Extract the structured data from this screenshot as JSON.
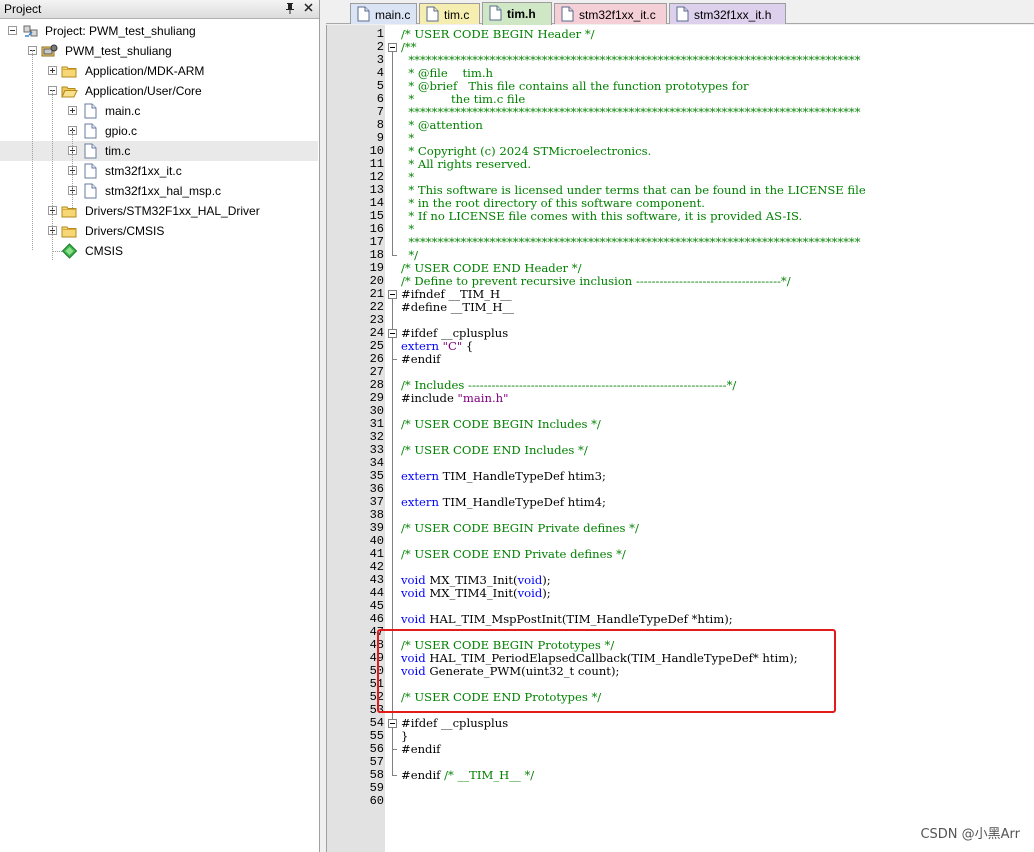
{
  "project_panel": {
    "title": "Project",
    "pin_icon": "pin-icon",
    "close_icon": "close-icon",
    "tree": [
      {
        "label": "Project: PWM_test_shuliang",
        "icon": "project-icon",
        "depth": 0,
        "toggle": "minus"
      },
      {
        "label": "PWM_test_shuliang",
        "icon": "target-icon",
        "depth": 1,
        "toggle": "minus"
      },
      {
        "label": "Application/MDK-ARM",
        "icon": "folder-icon",
        "depth": 2,
        "toggle": "plus"
      },
      {
        "label": "Application/User/Core",
        "icon": "folder-open-icon",
        "depth": 2,
        "toggle": "minus"
      },
      {
        "label": "main.c",
        "icon": "file-icon",
        "depth": 3,
        "toggle": "plus"
      },
      {
        "label": "gpio.c",
        "icon": "file-icon",
        "depth": 3,
        "toggle": "plus"
      },
      {
        "label": "tim.c",
        "icon": "file-icon",
        "depth": 3,
        "toggle": "plus",
        "selected": true
      },
      {
        "label": "stm32f1xx_it.c",
        "icon": "file-icon",
        "depth": 3,
        "toggle": "plus"
      },
      {
        "label": "stm32f1xx_hal_msp.c",
        "icon": "file-icon",
        "depth": 3,
        "toggle": "plus"
      },
      {
        "label": "Drivers/STM32F1xx_HAL_Driver",
        "icon": "folder-icon",
        "depth": 2,
        "toggle": "plus"
      },
      {
        "label": "Drivers/CMSIS",
        "icon": "folder-icon",
        "depth": 2,
        "toggle": "plus"
      },
      {
        "label": "CMSIS",
        "icon": "cmsis-gem-icon",
        "depth": 2,
        "toggle": "none"
      }
    ]
  },
  "tabs": [
    {
      "label": "main.c",
      "color": "#dbe4f5",
      "active": false
    },
    {
      "label": "tim.c",
      "color": "#f6eeb0",
      "active": false
    },
    {
      "label": "tim.h",
      "color": "#cfe7c4",
      "active": true
    },
    {
      "label": "stm32f1xx_it.c",
      "color": "#f4cfd6",
      "active": false
    },
    {
      "label": "stm32f1xx_it.h",
      "color": "#ddd0ec",
      "active": false
    }
  ],
  "editor": {
    "file": "tim.h",
    "lines": [
      {
        "n": "1",
        "text": "/* USER CODE BEGIN Header */"
      },
      {
        "n": "2",
        "text": "/**"
      },
      {
        "n": "3",
        "text": "  ******************************************************************************"
      },
      {
        "n": "4",
        "text": "  * @file    tim.h"
      },
      {
        "n": "5",
        "text": "  * @brief   This file contains all the function prototypes for"
      },
      {
        "n": "6",
        "text": "  *          the tim.c file"
      },
      {
        "n": "7",
        "text": "  ******************************************************************************"
      },
      {
        "n": "8",
        "text": "  * @attention"
      },
      {
        "n": "9",
        "text": "  *"
      },
      {
        "n": "10",
        "text": "  * Copyright (c) 2024 STMicroelectronics."
      },
      {
        "n": "11",
        "text": "  * All rights reserved."
      },
      {
        "n": "12",
        "text": "  *"
      },
      {
        "n": "13",
        "text": "  * This software is licensed under terms that can be found in the LICENSE file"
      },
      {
        "n": "14",
        "text": "  * in the root directory of this software component."
      },
      {
        "n": "15",
        "text": "  * If no LICENSE file comes with this software, it is provided AS-IS."
      },
      {
        "n": "16",
        "text": "  *"
      },
      {
        "n": "17",
        "text": "  ******************************************************************************"
      },
      {
        "n": "18",
        "text": "  */"
      },
      {
        "n": "19",
        "text": "/* USER CODE END Header */"
      },
      {
        "n": "20",
        "text": "/* Define to prevent recursive inclusion -------------------------------------*/"
      },
      {
        "n": "21",
        "text": "#ifndef __TIM_H__"
      },
      {
        "n": "22",
        "text": "#define __TIM_H__"
      },
      {
        "n": "23",
        "text": ""
      },
      {
        "n": "24",
        "text": "#ifdef __cplusplus"
      },
      {
        "n": "25",
        "text": "extern \"C\" {"
      },
      {
        "n": "26",
        "text": "#endif"
      },
      {
        "n": "27",
        "text": ""
      },
      {
        "n": "28",
        "text": "/* Includes ------------------------------------------------------------------*/"
      },
      {
        "n": "29",
        "text": "#include \"main.h\""
      },
      {
        "n": "30",
        "text": ""
      },
      {
        "n": "31",
        "text": "/* USER CODE BEGIN Includes */"
      },
      {
        "n": "32",
        "text": ""
      },
      {
        "n": "33",
        "text": "/* USER CODE END Includes */"
      },
      {
        "n": "34",
        "text": ""
      },
      {
        "n": "35",
        "text": "extern TIM_HandleTypeDef htim3;"
      },
      {
        "n": "36",
        "text": ""
      },
      {
        "n": "37",
        "text": "extern TIM_HandleTypeDef htim4;"
      },
      {
        "n": "38",
        "text": ""
      },
      {
        "n": "39",
        "text": "/* USER CODE BEGIN Private defines */"
      },
      {
        "n": "40",
        "text": ""
      },
      {
        "n": "41",
        "text": "/* USER CODE END Private defines */"
      },
      {
        "n": "42",
        "text": ""
      },
      {
        "n": "43",
        "text": "void MX_TIM3_Init(void);"
      },
      {
        "n": "44",
        "text": "void MX_TIM4_Init(void);"
      },
      {
        "n": "45",
        "text": ""
      },
      {
        "n": "46",
        "text": "void HAL_TIM_MspPostInit(TIM_HandleTypeDef *htim);"
      },
      {
        "n": "47",
        "text": ""
      },
      {
        "n": "48",
        "text": "/* USER CODE BEGIN Prototypes */"
      },
      {
        "n": "49",
        "text": "void HAL_TIM_PeriodElapsedCallback(TIM_HandleTypeDef* htim);"
      },
      {
        "n": "50",
        "text": "void Generate_PWM(uint32_t count);"
      },
      {
        "n": "51",
        "text": ""
      },
      {
        "n": "52",
        "text": "/* USER CODE END Prototypes */"
      },
      {
        "n": "53",
        "text": ""
      },
      {
        "n": "54",
        "text": "#ifdef __cplusplus"
      },
      {
        "n": "55",
        "text": "}"
      },
      {
        "n": "56",
        "text": "#endif"
      },
      {
        "n": "57",
        "text": ""
      },
      {
        "n": "58",
        "text": "#endif /* __TIM_H__ */"
      },
      {
        "n": "59",
        "text": ""
      },
      {
        "n": "60",
        "text": ""
      }
    ],
    "highlight_color": "#e31b1b"
  },
  "watermark": "CSDN @小黑Arr"
}
